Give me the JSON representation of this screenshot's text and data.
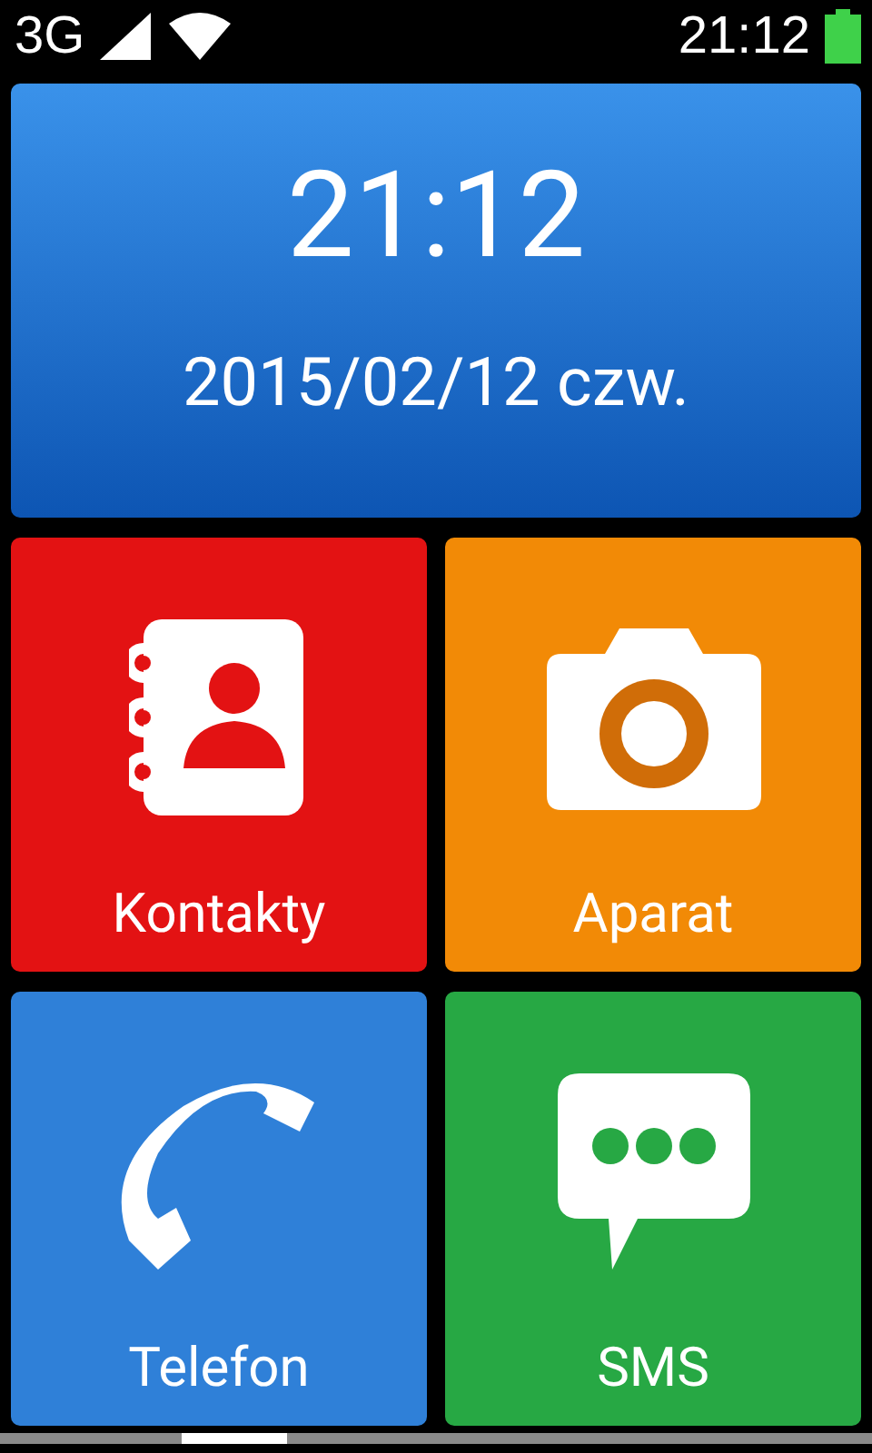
{
  "status_bar": {
    "network": "3G",
    "time": "21:12"
  },
  "clock": {
    "time": "21:12",
    "date": "2015/02/12 czw."
  },
  "tiles": [
    {
      "label": "Kontakty",
      "kind": "contacts",
      "color": "#e31213"
    },
    {
      "label": "Aparat",
      "kind": "camera",
      "color": "#f28a06"
    },
    {
      "label": "Telefon",
      "kind": "phone",
      "color": "#2f80d8"
    },
    {
      "label": "SMS",
      "kind": "sms",
      "color": "#27a844"
    }
  ]
}
